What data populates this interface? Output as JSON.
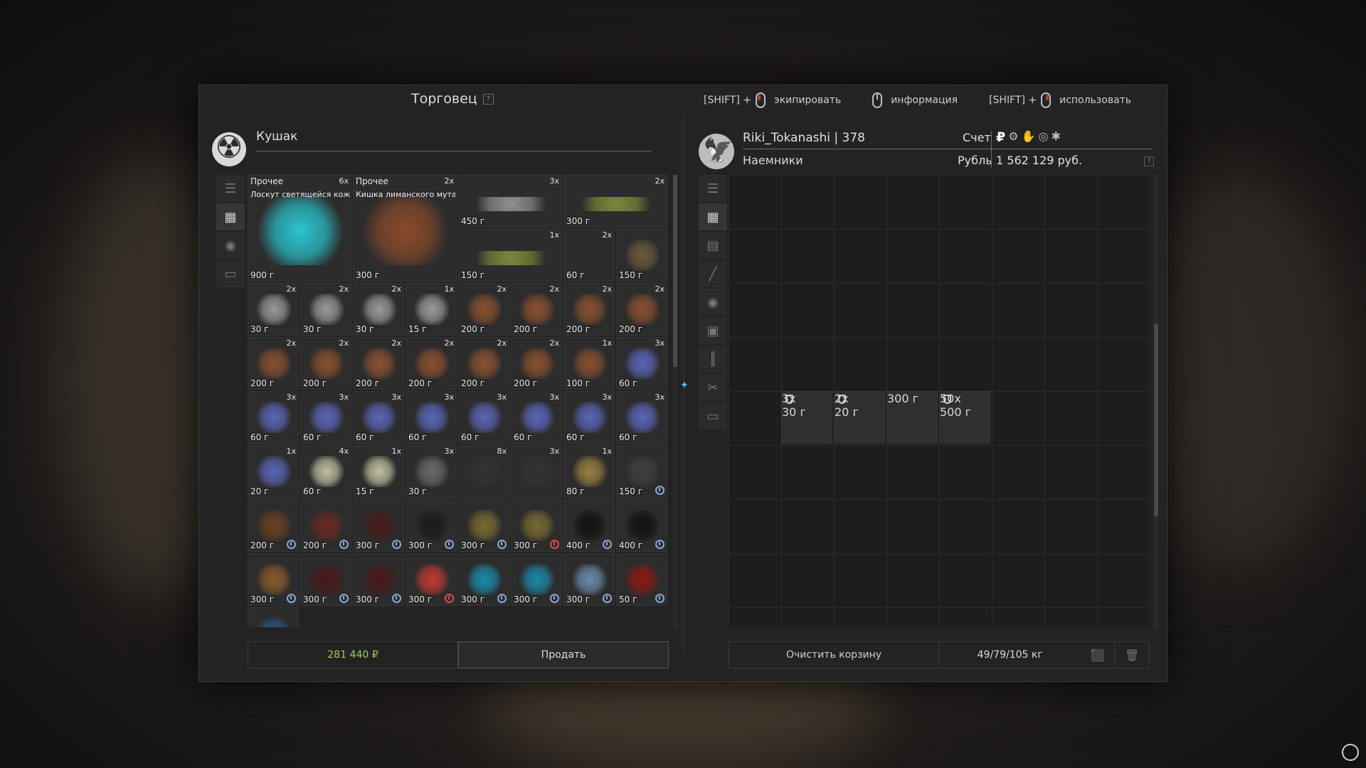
{
  "title": "Торговец",
  "hints": [
    {
      "prefix": "[SHIFT] +",
      "label": "экипировать",
      "icon": "mouse-left-icon"
    },
    {
      "prefix": "",
      "label": "информация",
      "icon": "mouse-middle-icon"
    },
    {
      "prefix": "[SHIFT] +",
      "label": "использовать",
      "icon": "mouse-right-icon"
    }
  ],
  "trader": {
    "name": "Кушак",
    "icon": "radiation-icon"
  },
  "left_tabs": [
    "sort-icon",
    "grid-icon",
    "artifact-icon",
    "archive-icon"
  ],
  "trader_items": [
    {
      "cat": "Прочее",
      "name": "Лоскут светящейся кож...",
      "qty": "6x",
      "price": "900 г",
      "color": "#29c6d0"
    },
    {
      "cat": "Прочее",
      "name": "Кишка лиманского мута...",
      "qty": "2x",
      "price": "300 г",
      "color": "#8a4a2a"
    },
    {
      "qty": "3x",
      "price": "450 г",
      "color": "#8f8f8f"
    },
    {
      "qty": "2x",
      "price": "300 г",
      "color": "#7a8a3a"
    },
    {
      "qty": "1x",
      "price": "150 г",
      "color": "#7a8a3a"
    },
    {
      "qty": "2x",
      "price": "60 г",
      "color": "#2a2a2a"
    },
    {
      "qty": "",
      "price": "150 г",
      "color": "#6a5a3a"
    },
    {
      "qty": "2x",
      "price": "30 г",
      "color": "#9a9a9a"
    },
    {
      "qty": "2x",
      "price": "30 г",
      "color": "#9a9a9a"
    },
    {
      "qty": "2x",
      "price": "30 г",
      "color": "#9a9a9a"
    },
    {
      "qty": "1x",
      "price": "15 г",
      "color": "#9a9a9a"
    },
    {
      "qty": "2x",
      "price": "200 г",
      "color": "#8a5030"
    },
    {
      "qty": "2x",
      "price": "200 г",
      "color": "#8a5030"
    },
    {
      "qty": "2x",
      "price": "200 г",
      "color": "#8a5030"
    },
    {
      "qty": "2x",
      "price": "200 г",
      "color": "#8a5030"
    },
    {
      "qty": "2x",
      "price": "200 г",
      "color": "#8a5030"
    },
    {
      "qty": "2x",
      "price": "200 г",
      "color": "#8a5030"
    },
    {
      "qty": "2x",
      "price": "200 г",
      "color": "#8a5030"
    },
    {
      "qty": "2x",
      "price": "200 г",
      "color": "#8a5030"
    },
    {
      "qty": "2x",
      "price": "200 г",
      "color": "#8a5030"
    },
    {
      "qty": "2x",
      "price": "200 г",
      "color": "#8a5030"
    },
    {
      "qty": "1x",
      "price": "100 г",
      "color": "#8a5030"
    },
    {
      "qty": "3x",
      "price": "60 г",
      "color": "#5a66b8"
    },
    {
      "qty": "3x",
      "price": "60 г",
      "color": "#5a66b8"
    },
    {
      "qty": "3x",
      "price": "60 г",
      "color": "#5a66b8"
    },
    {
      "qty": "3x",
      "price": "60 г",
      "color": "#5a66b8"
    },
    {
      "qty": "3x",
      "price": "60 г",
      "color": "#5a66b8"
    },
    {
      "qty": "3x",
      "price": "60 г",
      "color": "#5a66b8"
    },
    {
      "qty": "3x",
      "price": "60 г",
      "color": "#5a66b8"
    },
    {
      "qty": "3x",
      "price": "60 г",
      "color": "#5a66b8"
    },
    {
      "qty": "3x",
      "price": "60 г",
      "color": "#5a66b8"
    },
    {
      "qty": "1x",
      "price": "20 г",
      "color": "#5a66b8"
    },
    {
      "qty": "4x",
      "price": "60 г",
      "color": "#c0c0a0"
    },
    {
      "qty": "1x",
      "price": "15 г",
      "color": "#c0c0a0"
    },
    {
      "qty": "3x",
      "price": "30 г",
      "color": "#6a6a6a"
    },
    {
      "qty": "8x",
      "price": "",
      "color": "#333333"
    },
    {
      "qty": "3x",
      "price": "",
      "color": "#333333"
    },
    {
      "qty": "1x",
      "price": "80 г",
      "color": "#9a8040"
    },
    {
      "qty": "",
      "price": "150 г",
      "color": "#404040",
      "clock": "blue"
    },
    {
      "qty": "",
      "price": "200 г",
      "color": "#6a4020",
      "clock": "blue"
    },
    {
      "qty": "",
      "price": "200 г",
      "color": "#6a2a20",
      "clock": "blue"
    },
    {
      "qty": "",
      "price": "300 г",
      "color": "#4a1a1a",
      "clock": "blue"
    },
    {
      "qty": "",
      "price": "300 г",
      "color": "#1a1a1a",
      "clock": "blue"
    },
    {
      "qty": "",
      "price": "300 г",
      "color": "#7a6a30",
      "clock": "blue"
    },
    {
      "qty": "",
      "price": "300 г",
      "color": "#7a6a30",
      "clock": "red"
    },
    {
      "qty": "",
      "price": "400 г",
      "color": "#111111",
      "clock": "blue"
    },
    {
      "qty": "",
      "price": "400 г",
      "color": "#111111",
      "clock": "blue"
    },
    {
      "qty": "",
      "price": "300 г",
      "color": "#8a5a2a",
      "clock": "blue"
    },
    {
      "qty": "",
      "price": "300 г",
      "color": "#4a1818",
      "clock": "blue"
    },
    {
      "qty": "",
      "price": "300 г",
      "color": "#4a1818",
      "clock": "blue"
    },
    {
      "qty": "",
      "price": "300 г",
      "color": "#c03a30",
      "clock": "red"
    },
    {
      "qty": "",
      "price": "300 г",
      "color": "#1a8aaa",
      "clock": "blue"
    },
    {
      "qty": "",
      "price": "300 г",
      "color": "#1a8aaa",
      "clock": "blue"
    },
    {
      "qty": "",
      "price": "300 г",
      "color": "#6a8aaa",
      "clock": "blue"
    },
    {
      "qty": "",
      "price": "50 г",
      "color": "#8a1a10",
      "clock": "blue"
    },
    {
      "qty": "",
      "price": "",
      "color": "#2a5a8a"
    }
  ],
  "sell_total": "281 440 ₽",
  "sell_button": "Продать",
  "player": {
    "name": "Riki_Tokanashi | 378",
    "group": "Наемники",
    "account_label": "Счет",
    "currency_label": "Рубль",
    "balance": "1 562 129 руб.",
    "currency_icons": [
      "₽",
      "gear-icon",
      "hand-icon",
      "coin-icon",
      "chip-icon"
    ]
  },
  "right_tabs": [
    "sort-icon",
    "grid-icon",
    "weapon-icon",
    "rifle-icon",
    "artifact-icon",
    "container-icon",
    "ammo-icon",
    "tools-icon",
    "archive-icon"
  ],
  "cart_items": [
    {
      "qty": "3x",
      "price": "30 г",
      "color": "#3a8a4a"
    },
    {
      "qty": "2x",
      "price": "20 г",
      "color": "#c08030"
    },
    {
      "qty": "",
      "price": "300 г",
      "color": "#1a1a1a",
      "clock": "blue"
    },
    {
      "qty": "50x",
      "price": "500 г",
      "color": "#c0e8ff"
    }
  ],
  "clear_cart": "Очистить корзину",
  "weight": "49/79/105 кг"
}
